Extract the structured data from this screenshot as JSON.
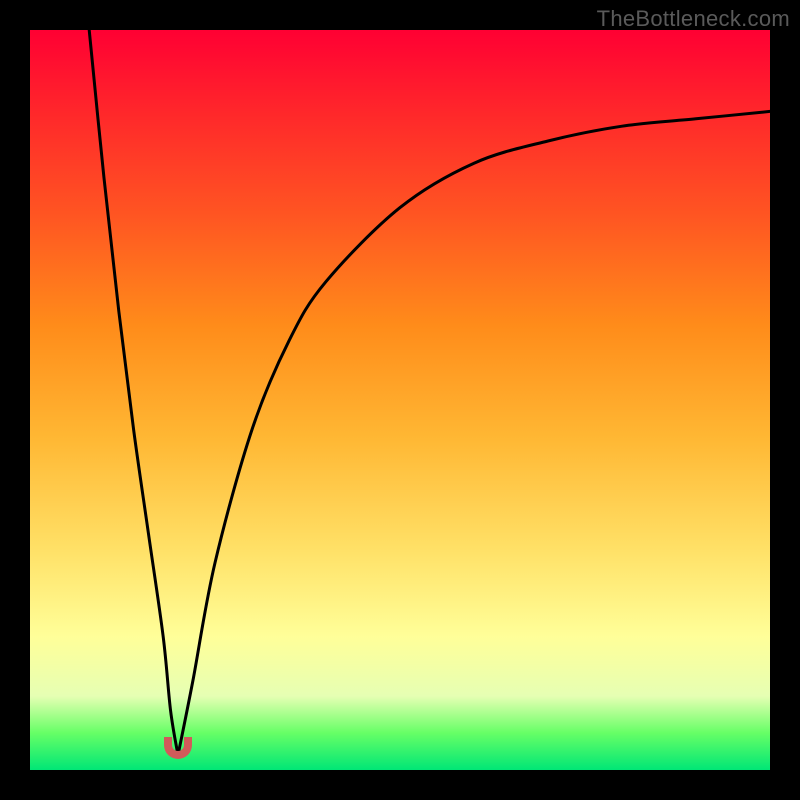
{
  "watermark": "TheBottleneck.com",
  "colors": {
    "curve": "#000000",
    "marker": "#d15a5a",
    "gradient_top": "#ff0033",
    "gradient_bottom": "#00e676"
  },
  "chart_data": {
    "type": "line",
    "title": "",
    "xlabel": "",
    "ylabel": "",
    "xlim": [
      0,
      100
    ],
    "ylim": [
      0,
      100
    ],
    "grid": false,
    "legend": false,
    "annotations": [
      {
        "name": "valley-marker",
        "x": 20,
        "y": 2
      }
    ],
    "series": [
      {
        "name": "left-branch",
        "x": [
          8,
          10,
          12,
          14,
          16,
          18,
          19,
          20
        ],
        "y": [
          100,
          80,
          62,
          46,
          32,
          18,
          8,
          2
        ]
      },
      {
        "name": "right-branch",
        "x": [
          20,
          22,
          25,
          30,
          35,
          40,
          50,
          60,
          70,
          80,
          90,
          100
        ],
        "y": [
          2,
          12,
          28,
          46,
          58,
          66,
          76,
          82,
          85,
          87,
          88,
          89
        ]
      }
    ]
  }
}
